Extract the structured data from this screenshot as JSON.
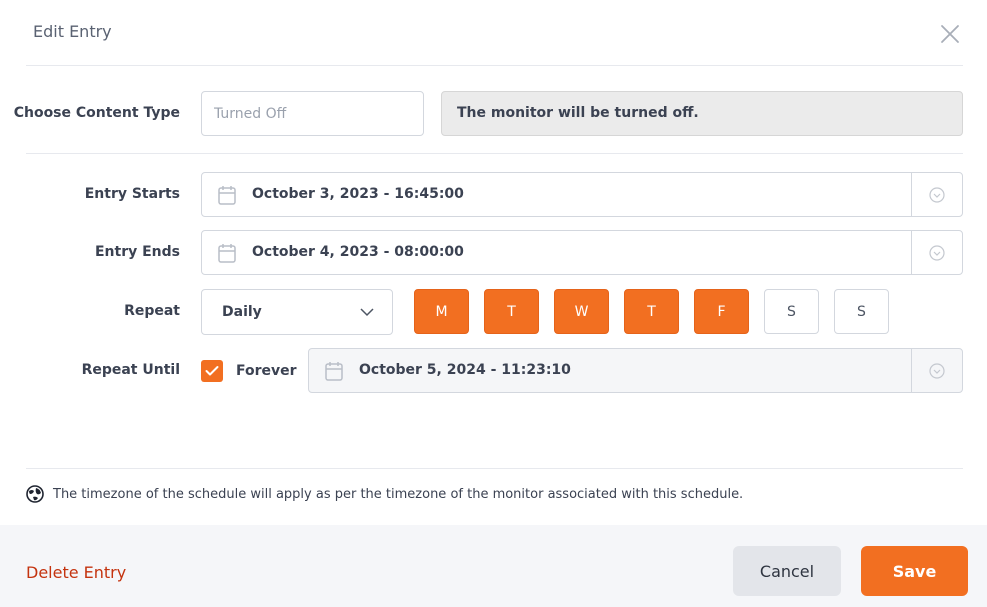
{
  "dialog": {
    "title": "Edit Entry"
  },
  "content_type": {
    "label": "Choose Content Type",
    "placeholder": "Turned Off",
    "value": "",
    "info": "The monitor will be turned off."
  },
  "entry_starts": {
    "label": "Entry Starts",
    "value": "October 3, 2023 - 16:45:00"
  },
  "entry_ends": {
    "label": "Entry Ends",
    "value": "October 4, 2023 - 08:00:00"
  },
  "repeat": {
    "label": "Repeat",
    "selected": "Daily",
    "days": [
      {
        "label": "M",
        "active": true
      },
      {
        "label": "T",
        "active": true
      },
      {
        "label": "W",
        "active": true
      },
      {
        "label": "T",
        "active": true
      },
      {
        "label": "F",
        "active": true
      },
      {
        "label": "S",
        "active": false
      },
      {
        "label": "S",
        "active": false
      }
    ]
  },
  "repeat_until": {
    "label": "Repeat Until",
    "forever_checked": true,
    "forever_label": "Forever",
    "value": "October 5, 2024 - 11:23:10"
  },
  "timezone_note": "The timezone of the schedule will apply as per the timezone of the monitor associated with this schedule.",
  "footer": {
    "delete_label": "Delete Entry",
    "cancel_label": "Cancel",
    "save_label": "Save"
  },
  "colors": {
    "accent": "#f26f21",
    "danger": "#c4330f"
  }
}
